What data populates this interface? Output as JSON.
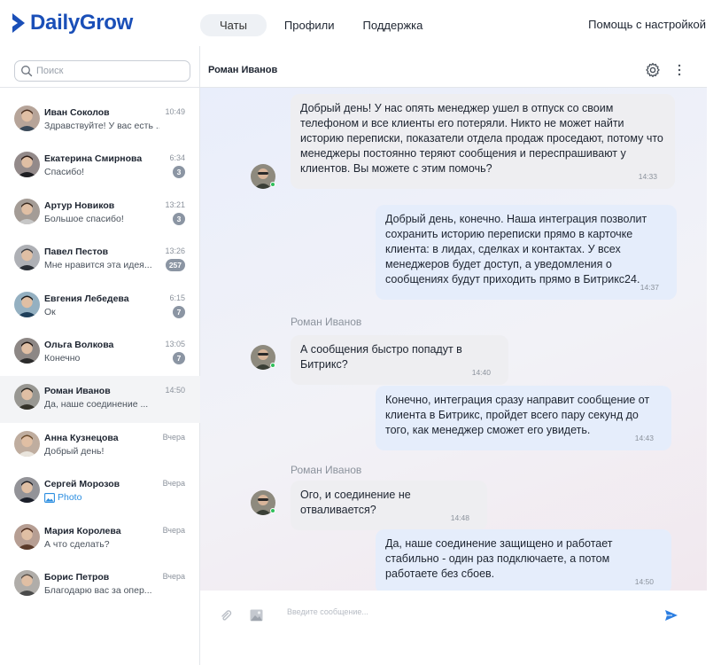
{
  "app": {
    "brand": "DailyGrow",
    "brand_color": "#1a4fb8"
  },
  "nav": {
    "tabs": [
      {
        "label": "Чаты",
        "active": true
      },
      {
        "label": "Профили"
      },
      {
        "label": "Поддержка"
      }
    ],
    "help_label": "Помощь с настройкой"
  },
  "search": {
    "placeholder": "Поиск"
  },
  "chats": [
    {
      "name": "Иван Соколов",
      "preview": "Здравствуйте! У вас есть ...",
      "time": "10:49",
      "badge": null,
      "avatar_color": "#7a5a46"
    },
    {
      "name": "Екатерина Смирнова",
      "preview": "Спасибо!",
      "time": "6:34",
      "badge": "3",
      "avatar_color": "#3a2a2a"
    },
    {
      "name": "Артур Новиков",
      "preview": "Большое спасибо!",
      "time": "13:21",
      "badge": "3",
      "avatar_color": "#5a4a40"
    },
    {
      "name": "Павел Пестов",
      "preview": "Мне нравится эта идея...",
      "time": "13:26",
      "badge": "257",
      "avatar_color": "#6b6f78"
    },
    {
      "name": "Евгения  Лебедева",
      "preview": "Ок",
      "time": "6:15",
      "badge": "7",
      "avatar_color": "#3d6f8e"
    },
    {
      "name": "Ольга Волкова",
      "preview": "Конечно",
      "time": "13:05",
      "badge": "7",
      "avatar_color": "#2f2420"
    },
    {
      "name": "Роман Иванов",
      "preview": "Да, наше соединение ...",
      "time": "14:50",
      "badge": null,
      "active": true,
      "avatar_color": "#4d4a3f"
    },
    {
      "name": "Анна Кузнецова",
      "preview": "Добрый день!",
      "time": "Вчера",
      "badge": null,
      "avatar_color": "#8a6a50"
    },
    {
      "name": "Сергей Морозов",
      "preview": "Photo",
      "photo": true,
      "time": "Вчера",
      "badge": null,
      "avatar_color": "#3b3a44"
    },
    {
      "name": "Мария Королева",
      "preview": "А что сделать?",
      "time": "Вчера",
      "badge": null,
      "avatar_color": "#7a4e3a"
    },
    {
      "name": "Борис  Петров",
      "preview": "Благодарю вас  за опер...",
      "time": "Вчера",
      "badge": null,
      "avatar_color": "#6f6a62"
    }
  ],
  "conversation": {
    "contact_name": "Роман Иванов",
    "sender_label": "Роман Иванов",
    "messages": [
      {
        "dir": "in",
        "text": "Добрый день! У нас опять менеджер ушел в отпуск со своим телефоном и все клиенты его потеряли. Никто не может найти историю переписки, показатели отдела продаж проседают, потому что менеджеры постоянно теряют сообщения и переспрашивают у клиентов. Вы можете с этим помочь?",
        "time": "14:33"
      },
      {
        "dir": "out",
        "text": "Добрый день, конечно. Наша интеграция позволит сохранить историю переписки прямо в карточке клиента: в лидах, сделках и контактах. У всех менеджеров будет доступ, а уведомления о сообщениях будут приходить прямо в Битрикс24.",
        "time": "14:37"
      },
      {
        "dir": "in",
        "text": "А сообщения быстро попадут в Битрикс?",
        "time": "14:40"
      },
      {
        "dir": "out",
        "text": "Конечно, интеграция сразу направит сообщение от клиента в Битрикс, пройдет всего пару секунд до того, как менеджер сможет его увидеть.",
        "time": "14:43"
      },
      {
        "dir": "in",
        "text": "Ого, и соединение не отваливается?",
        "time": "14:48"
      },
      {
        "dir": "out",
        "text": "Да, наше соединение защищено и работает стабильно - один раз подключаете, а потом работаете без сбоев.",
        "time": "14:50"
      }
    ]
  },
  "composer": {
    "placeholder": "Введите сообщение..."
  },
  "colors": {
    "send": "#2a7de1",
    "online": "#2fbf5b",
    "badge": "#8b95a3"
  }
}
